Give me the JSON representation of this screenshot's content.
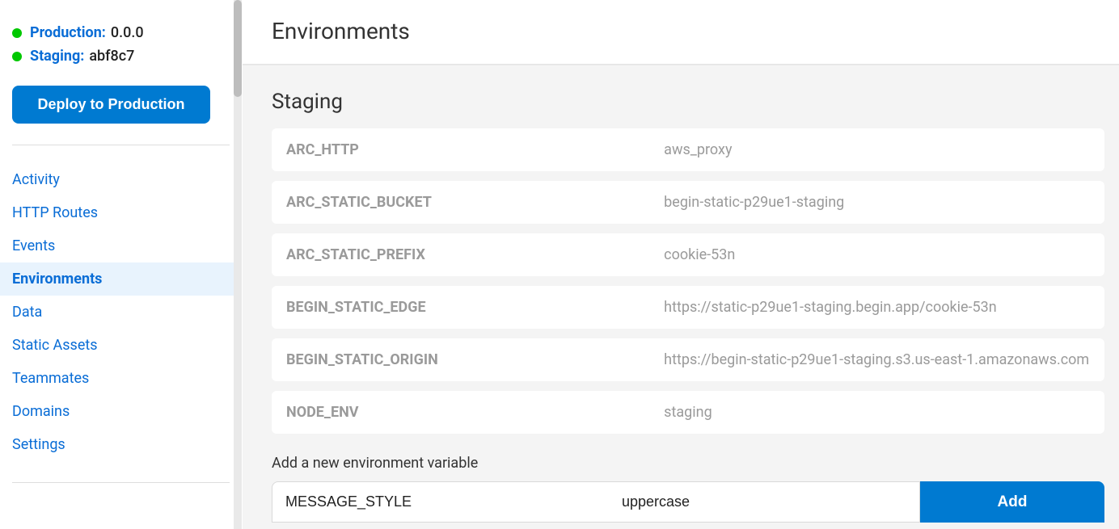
{
  "sidebar": {
    "status": [
      {
        "label": "Production:",
        "value": "0.0.0"
      },
      {
        "label": "Staging:",
        "value": "abf8c7"
      }
    ],
    "deploy_label": "Deploy to Production",
    "nav": [
      {
        "label": "Activity",
        "active": false
      },
      {
        "label": "HTTP Routes",
        "active": false
      },
      {
        "label": "Events",
        "active": false
      },
      {
        "label": "Environments",
        "active": true
      },
      {
        "label": "Data",
        "active": false
      },
      {
        "label": "Static Assets",
        "active": false
      },
      {
        "label": "Teammates",
        "active": false
      },
      {
        "label": "Domains",
        "active": false
      },
      {
        "label": "Settings",
        "active": false
      }
    ]
  },
  "page": {
    "title": "Environments"
  },
  "staging": {
    "title": "Staging",
    "vars": [
      {
        "key": "ARC_HTTP",
        "value": "aws_proxy"
      },
      {
        "key": "ARC_STATIC_BUCKET",
        "value": "begin-static-p29ue1-staging"
      },
      {
        "key": "ARC_STATIC_PREFIX",
        "value": "cookie-53n"
      },
      {
        "key": "BEGIN_STATIC_EDGE",
        "value": "https://static-p29ue1-staging.begin.app/cookie-53n"
      },
      {
        "key": "BEGIN_STATIC_ORIGIN",
        "value": "https://begin-static-p29ue1-staging.s3.us-east-1.amazonaws.com"
      },
      {
        "key": "NODE_ENV",
        "value": "staging"
      }
    ]
  },
  "add": {
    "label": "Add a new environment variable",
    "key_value": "MESSAGE_STYLE",
    "val_value": "uppercase",
    "button": "Add"
  }
}
